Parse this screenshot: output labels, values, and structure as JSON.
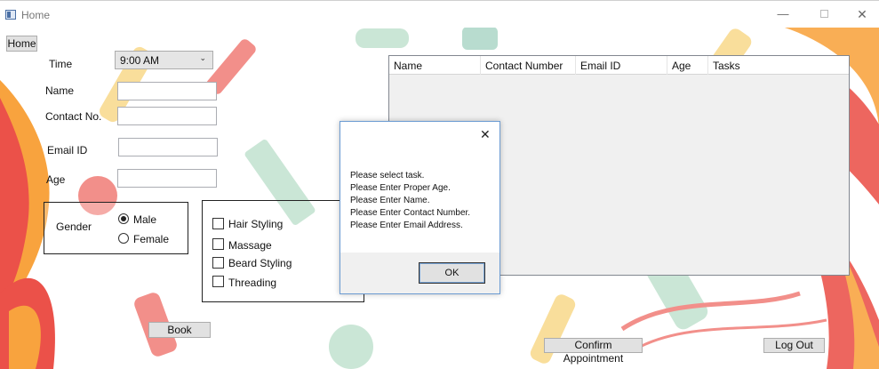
{
  "window": {
    "title": "Home",
    "minimize_glyph": "—",
    "close_glyph": "✕"
  },
  "toolbar": {
    "home_label": "Home"
  },
  "form": {
    "time_label": "Time",
    "time_value": "9:00 AM",
    "time_chevron": "⌄",
    "name_label": "Name",
    "name_value": "",
    "contact_label": "Contact No.",
    "contact_value": "",
    "email_label": "Email ID",
    "email_value": "",
    "age_label": "Age",
    "age_value": "",
    "gender_label": "Gender",
    "gender_options": [
      {
        "label": "Male",
        "checked": true
      },
      {
        "label": "Female",
        "checked": false
      }
    ],
    "tasks": [
      {
        "label": "Hair Styling",
        "checked": false
      },
      {
        "label": "Massage",
        "checked": false
      },
      {
        "label": "Beard Styling",
        "checked": false
      },
      {
        "label": "Threading",
        "checked": false
      }
    ],
    "book_label": "Book"
  },
  "grid": {
    "columns": [
      "Name",
      "Contact Number",
      "Email ID",
      "Age",
      "Tasks"
    ],
    "rows": []
  },
  "dialog": {
    "close_glyph": "✕",
    "messages": [
      "Please select task.",
      "Please Enter Proper Age.",
      "Please Enter Name.",
      "Please Enter Contact Number.",
      "Please Enter Email Address."
    ],
    "ok_label": "OK"
  },
  "footer": {
    "confirm_label": "Confirm Appointment",
    "logout_label": "Log Out"
  },
  "colors": {
    "accent_red": "#e8332a",
    "accent_orange": "#f7941d",
    "dialog_border": "#6b9bd2"
  }
}
